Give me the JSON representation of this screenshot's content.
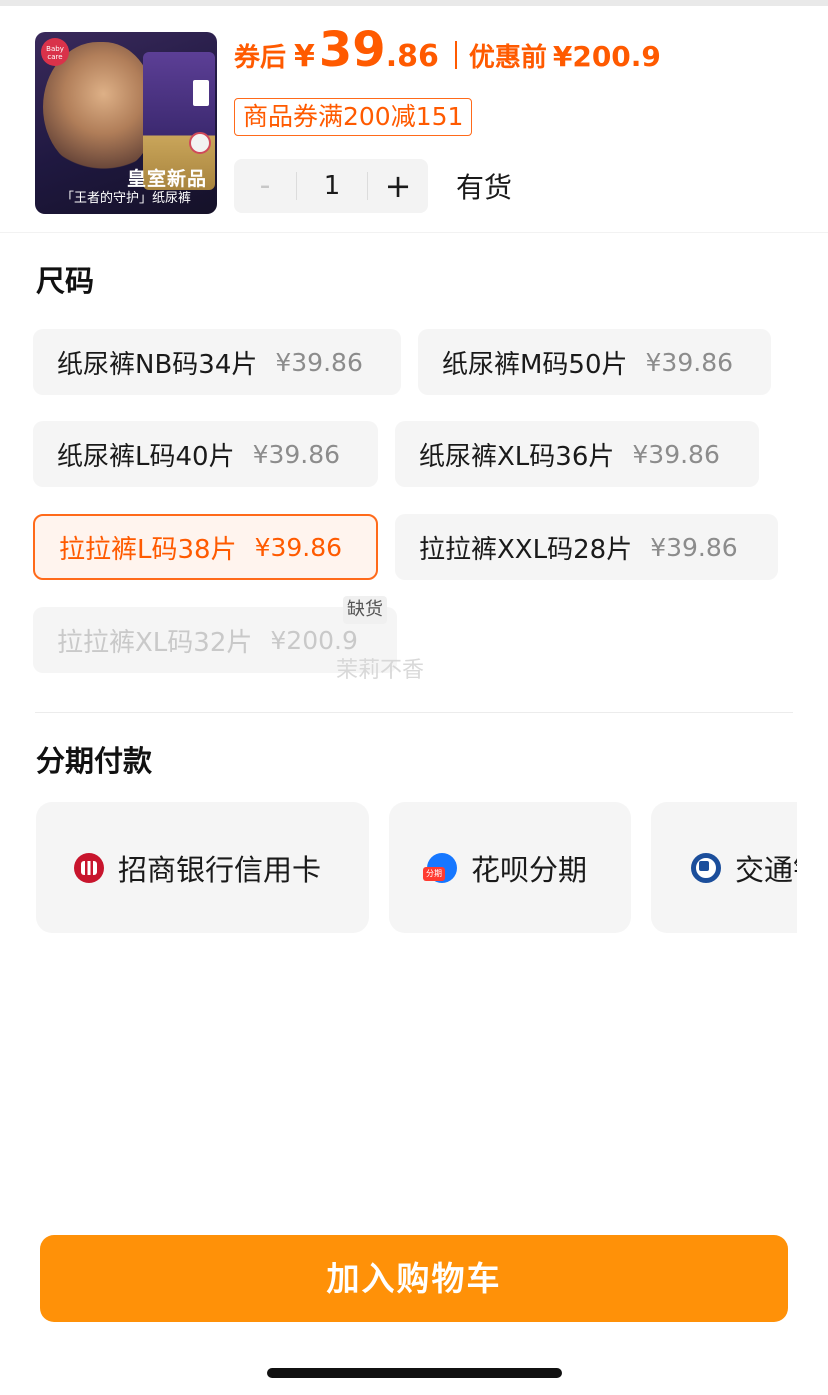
{
  "header": {
    "image_caption_line1": "皇室新品",
    "image_caption_line2": "「王者的守护」纸尿裤",
    "brand_logo_text": "Baby care",
    "price_after_coupon_label": "券后",
    "currency": "¥",
    "price_int": "39",
    "price_dec": ".86",
    "pre_discount_label": "优惠前",
    "pre_discount_price": "¥200.9",
    "coupon_text": "商品券满200减151",
    "quantity_minus": "-",
    "quantity": "1",
    "quantity_plus": "+",
    "stock_status": "有货"
  },
  "size_section": {
    "title": "尺码",
    "options": [
      {
        "name": "纸尿裤NB码34片",
        "price": "¥39.86",
        "state": "normal"
      },
      {
        "name": "纸尿裤M码50片",
        "price": "¥39.86",
        "state": "normal"
      },
      {
        "name": "纸尿裤L码40片",
        "price": "¥39.86",
        "state": "normal"
      },
      {
        "name": "纸尿裤XL码36片",
        "price": "¥39.86",
        "state": "normal"
      },
      {
        "name": "拉拉裤L码38片",
        "price": "¥39.86",
        "state": "selected"
      },
      {
        "name": "拉拉裤XXL码28片",
        "price": "¥39.86",
        "state": "normal"
      },
      {
        "name": "拉拉裤XL码32片",
        "price": "¥200.9",
        "state": "disabled"
      }
    ],
    "out_of_stock_badge": "缺货",
    "watermark": "茉莉不香"
  },
  "installment_section": {
    "title": "分期付款",
    "options": [
      {
        "label": "招商银行信用卡",
        "icon": "cmb-bank-icon"
      },
      {
        "label": "花呗分期",
        "icon": "huabei-icon",
        "icon_badge": "分期"
      },
      {
        "label": "交通银行",
        "icon": "bocom-bank-icon"
      }
    ]
  },
  "footer": {
    "add_to_cart_label": "加入购物车"
  },
  "colors": {
    "accent_orange": "#ff5a00",
    "cta_orange": "#ff9108",
    "chip_bg": "#f5f5f5"
  }
}
